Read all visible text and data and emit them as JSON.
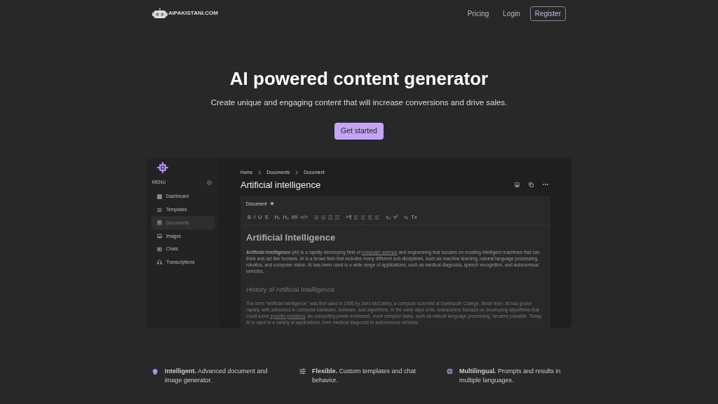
{
  "header": {
    "logo_text": "AIPAKISTANI.COM",
    "nav": [
      {
        "label": "Pricing"
      },
      {
        "label": "Login"
      }
    ],
    "register": "Register"
  },
  "hero": {
    "title": "AI powered content generator",
    "subtitle": "Create unique and engaging content that will increase conversions and drive sales.",
    "cta": "Get started"
  },
  "app": {
    "sidebar": {
      "menu_label": "MENU",
      "items": [
        {
          "label": "Dashboard",
          "kind": "dashboard",
          "selected": false
        },
        {
          "label": "Templates",
          "kind": "grid",
          "selected": false
        },
        {
          "label": "Documents",
          "kind": "document",
          "selected": true
        },
        {
          "label": "Images",
          "kind": "image",
          "selected": false
        },
        {
          "label": "Chats",
          "kind": "chat",
          "selected": false
        },
        {
          "label": "Transcriptions",
          "kind": "headphones",
          "selected": false
        }
      ]
    },
    "breadcrumbs": [
      "Home",
      "Documents",
      "Document"
    ],
    "title": "Artificial intelligence",
    "editor": {
      "tab": "Document",
      "toolbar": [
        [
          {
            "kind": "glyph",
            "text": "B"
          },
          {
            "kind": "glyph",
            "text": "I"
          },
          {
            "kind": "glyph",
            "text": "U"
          },
          {
            "kind": "glyph",
            "text": "S"
          }
        ],
        [
          {
            "kind": "glyph",
            "text": "H₁"
          },
          {
            "kind": "glyph",
            "text": "H₂"
          },
          {
            "kind": "glyph",
            "text": "99"
          },
          {
            "kind": "glyph",
            "text": "</>"
          }
        ],
        [
          {
            "kind": "list"
          },
          {
            "kind": "list"
          },
          {
            "kind": "indent"
          },
          {
            "kind": "indent"
          }
        ],
        [
          {
            "kind": "glyph",
            "text": "+¶"
          },
          {
            "kind": "align"
          },
          {
            "kind": "align"
          },
          {
            "kind": "align"
          },
          {
            "kind": "align"
          }
        ],
        [
          {
            "kind": "glyph",
            "text": "x₂"
          },
          {
            "kind": "glyph",
            "text": "x²"
          }
        ],
        [
          {
            "kind": "link"
          },
          {
            "kind": "glyph",
            "text": "Tx"
          }
        ]
      ],
      "heading": "Artificial Intelligence",
      "paragraph": {
        "before": "**Artificial Intelligence** (AI) is a rapidly developing field of ",
        "link": "computer science",
        "after": " and engineering that focuses on creating intelligent machines that can think and act like humans. AI is a broad field that includes many different sub-disciplines, such as machine learning, natural language processing, robotics, and computer vision. AI has been used in a wide range of applications, such as medical diagnosis, speech recognition, and autonomous vehicles."
      },
      "subheading": "History of Artificial Intelligence",
      "paragraph2": {
        "before": "The term \"artificial intelligence\" was first used in 1956 by John McCarthy, a computer scientist at Dartmouth College. Since then, AI has grown rapidly, with advances in computer hardware, software, and algorithms. In the early days of AI, researchers focused on developing algorithms that could solve ",
        "link": "specific problems",
        "after": ". As computing power increased, more complex tasks, such as natural language processing, became possible. Today, AI is used in a variety of applications, from medical diagnosis to autonomous vehicles."
      }
    }
  },
  "features": [
    {
      "kind": "brain",
      "text": "**Intelligent.** Advanced document and image generator."
    },
    {
      "kind": "sliders",
      "text": "**Flexible.** Custom templates and chat behavior."
    },
    {
      "kind": "globe",
      "text": "**Multilingual.** Prompts and results in multiple languages."
    }
  ]
}
